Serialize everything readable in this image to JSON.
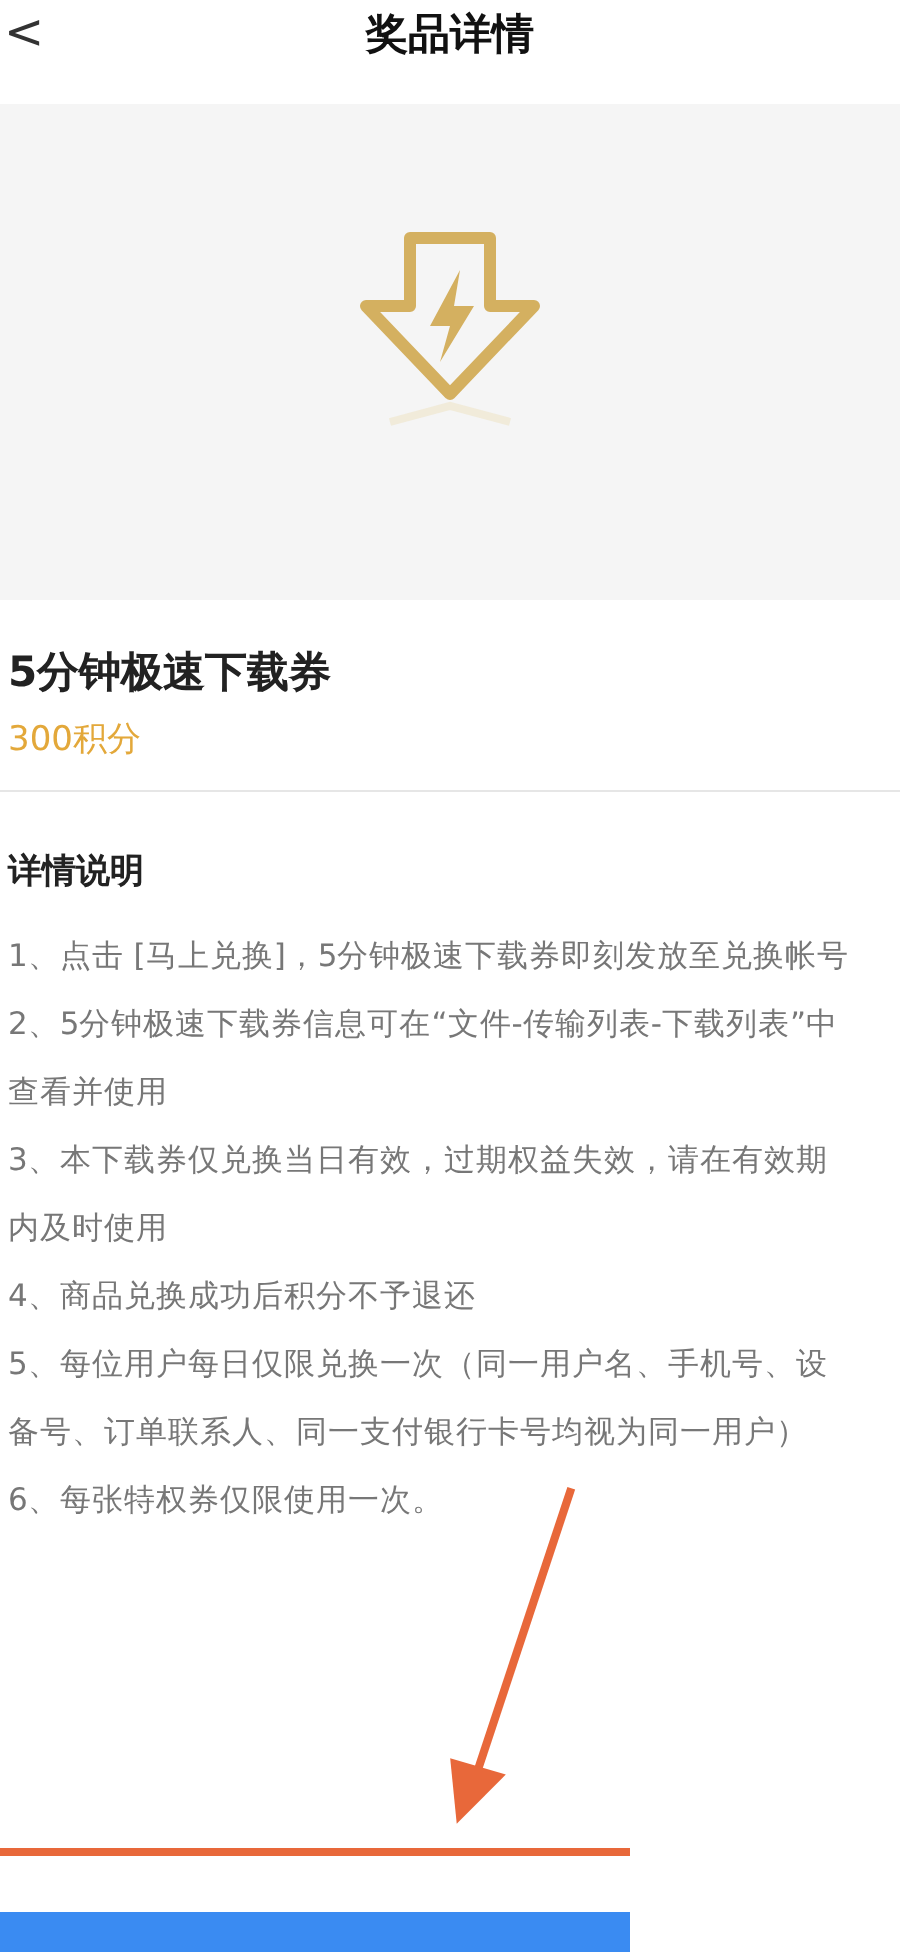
{
  "header": {
    "back": "<",
    "title": "奖品详情"
  },
  "prize": {
    "image": {
      "kind": "icon"
    },
    "name": "5分钟极速下载券",
    "points": "300积分"
  },
  "details": {
    "heading": "详情说明",
    "items": [
      "1、点击 [马上兑换]，5分钟极速下载券即刻发放至兑换帐号",
      "2、5分钟极速下载券信息可在“文件-传输列表-下载列表”中查看并使用",
      "3、本下载券仅兑换当日有效，过期权益失效，请在有效期内及时使用",
      "4、商品兑换成功后积分不予退还",
      "5、每位用户每日仅限兑换一次（同一用户名、手机号、设备号、订单联系人、同一支付银行卡号均视为同一用户）",
      "6、每张特权券仅限使用一次。"
    ]
  }
}
